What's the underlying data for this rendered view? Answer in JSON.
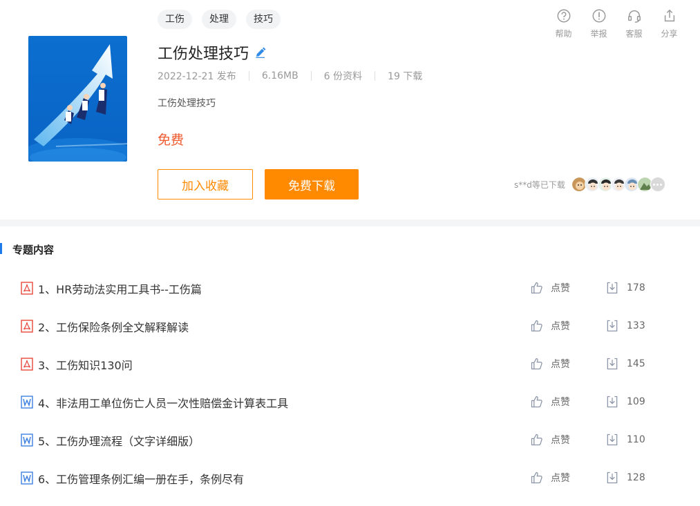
{
  "header": {
    "tags": [
      "工伤",
      "处理",
      "技巧"
    ],
    "title": "工伤处理技巧",
    "meta": {
      "date": "2022-12-21 发布",
      "size": "6.16MB",
      "count": "6 份资料",
      "downloads": "19 下载"
    },
    "description": "工伤处理技巧",
    "price": "免费",
    "buttons": {
      "favorite": "加入收藏",
      "download": "免费下载"
    },
    "actions": [
      {
        "icon": "help-icon",
        "label": "帮助"
      },
      {
        "icon": "report-icon",
        "label": "举报"
      },
      {
        "icon": "headset-icon",
        "label": "客服"
      },
      {
        "icon": "share-icon",
        "label": "分享"
      }
    ],
    "downloaded_by": "s**d等已下载"
  },
  "section": {
    "title": "专题内容"
  },
  "items": [
    {
      "type": "pdf",
      "name": "1、HR劳动法实用工具书--工伤篇",
      "like": "点赞",
      "downloads": "178"
    },
    {
      "type": "pdf",
      "name": "2、工伤保险条例全文解释解读",
      "like": "点赞",
      "downloads": "133"
    },
    {
      "type": "pdf",
      "name": "3、工伤知识130问",
      "like": "点赞",
      "downloads": "145"
    },
    {
      "type": "word",
      "name": "4、非法用工单位伤亡人员一次性赔偿金计算表工具",
      "like": "点赞",
      "downloads": "109"
    },
    {
      "type": "word",
      "name": "5、工伤办理流程（文字详细版）",
      "like": "点赞",
      "downloads": "110"
    },
    {
      "type": "word",
      "name": "6、工伤管理条例汇编一册在手，条例尽有",
      "like": "点赞",
      "downloads": "128"
    }
  ],
  "colors": {
    "accent": "#ff8a00",
    "price": "#f0582d",
    "pdf": "#e8463a",
    "word": "#3d7fe0"
  }
}
